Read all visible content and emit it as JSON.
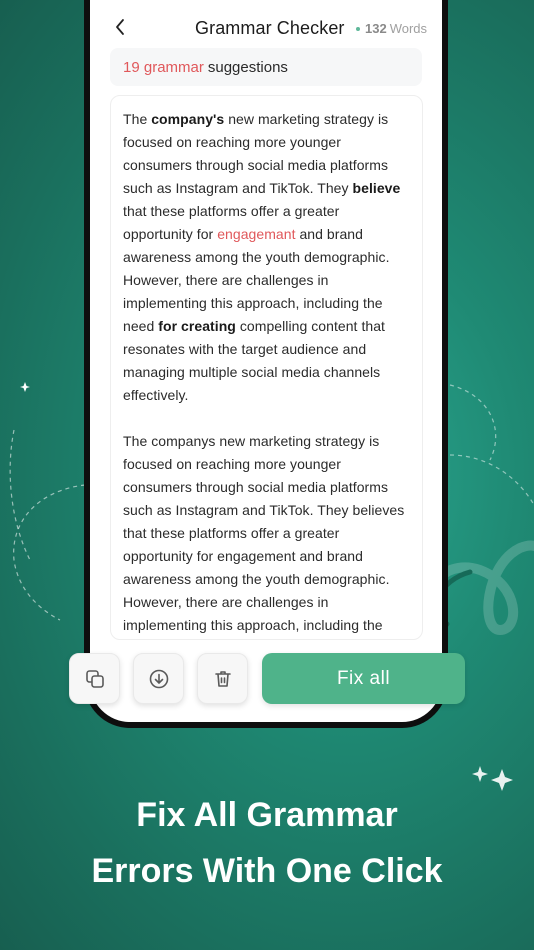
{
  "header": {
    "title": "Grammar Checker",
    "word_count": "132",
    "word_count_unit": "Words"
  },
  "suggestions": {
    "count_text": "19 grammar",
    "label": "suggestions"
  },
  "paragraph1": {
    "s1": "The ",
    "s2": "company's",
    "s3": " new marketing strategy is focused on reaching more younger consumers through social media platforms such as Instagram and TikTok. They ",
    "s4": "believe",
    "s5": " that these platforms offer a greater opportunity for ",
    "s6": "engagemant",
    "s7": " and brand awareness among the youth demographic. However, there are challenges in implementing this approach, including the need ",
    "s8": "for creating",
    "s9": " compelling content that resonates with the target audience and managing multiple social media channels effectively."
  },
  "paragraph2": {
    "text": "The companys new marketing strategy is focused on reaching more younger consumers through social media platforms such as Instagram and TikTok. They believes that these platforms offer a greater opportunity for engagement and brand awareness among the youth demographic. However, there are challenges in implementing this approach, including the need for creating compelling content that resonates with the target audience and managing multiple social media channels effectively."
  },
  "toolbar": {
    "copy_icon": "copy-icon",
    "download_icon": "download-icon",
    "delete_icon": "trash-icon",
    "fix_all_label": "Fix all"
  },
  "promo": {
    "line1": "Fix All Grammar",
    "line2": "Errors With One Click"
  },
  "colors": {
    "accent": "#4fb38a",
    "error": "#e0585b",
    "background": "#1f8a74"
  }
}
